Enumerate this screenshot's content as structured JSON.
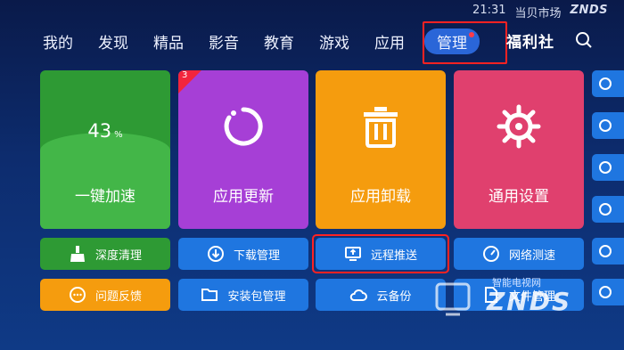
{
  "status": {
    "time": "21:31",
    "brand": "当贝市场",
    "logo": "ZNDS"
  },
  "nav": {
    "items": [
      "我的",
      "发现",
      "精品",
      "影音",
      "教育",
      "游戏",
      "应用"
    ],
    "active": "管理",
    "welfare": "福利社"
  },
  "tiles": {
    "speed": {
      "percent": "43",
      "unit": "%",
      "label": "一键加速"
    },
    "update": {
      "label": "应用更新",
      "badge": "3"
    },
    "uninstall": {
      "label": "应用卸载"
    },
    "settings": {
      "label": "通用设置"
    }
  },
  "buttons": {
    "deep_clean": "深度清理",
    "feedback": "问题反馈",
    "download": "下载管理",
    "package": "安装包管理",
    "remote": "远程推送",
    "cloud": "云备份",
    "speedtest": "网络测速",
    "filemgr": "文件管理"
  },
  "watermark": {
    "main": "ZNDS",
    "sub": "智能电视网"
  },
  "colors": {
    "green": "#2e9a34",
    "purple": "#a63fd6",
    "orange": "#f59c0e",
    "pink": "#e0406e",
    "blue": "#1f76e0",
    "highlight": "#ff2222"
  }
}
